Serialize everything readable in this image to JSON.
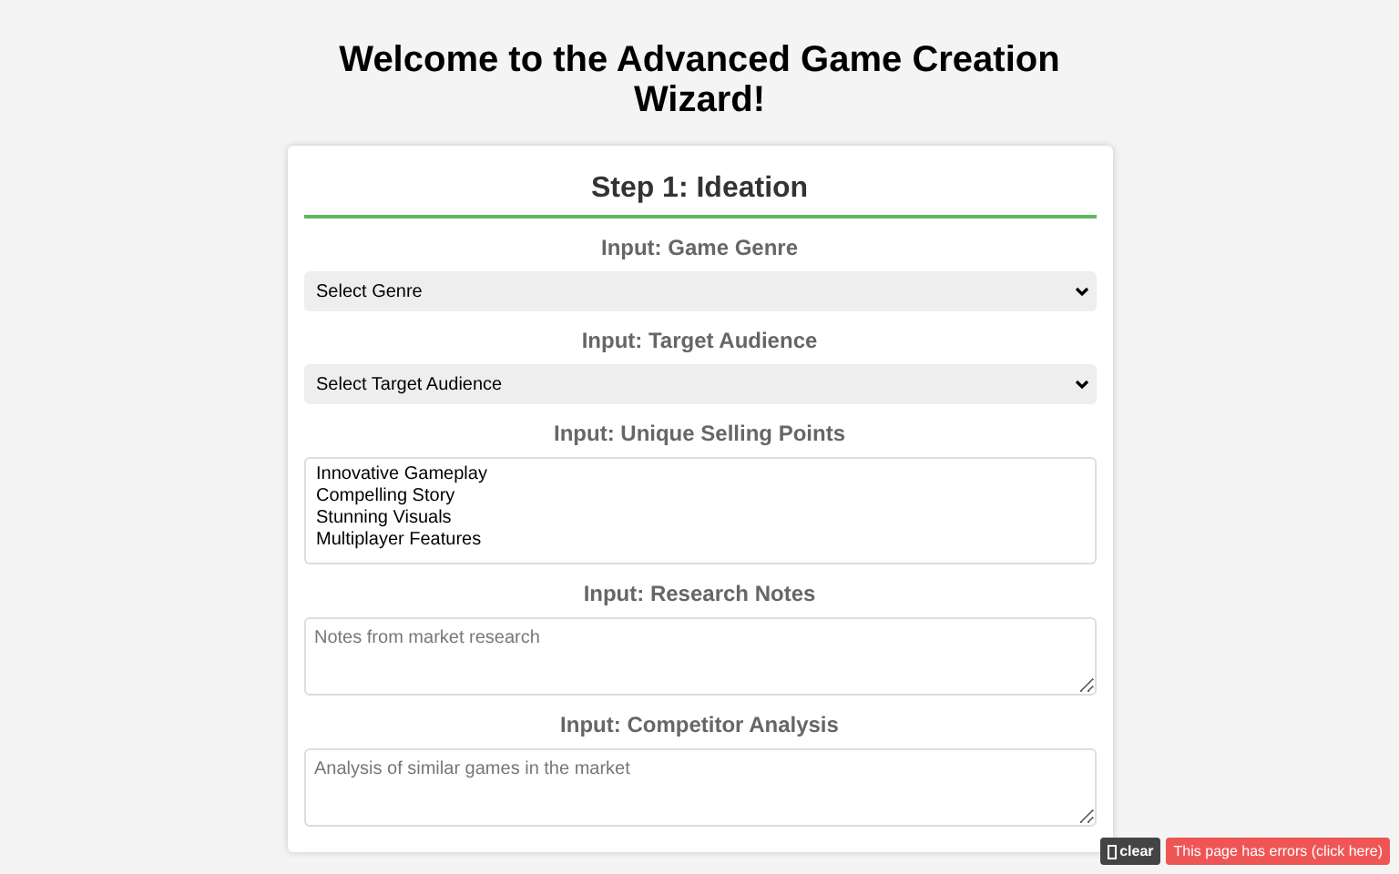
{
  "title": "Welcome to the Advanced Game Creation Wizard!",
  "step": {
    "heading": "Step 1: Ideation",
    "fields": [
      {
        "kind": "select",
        "label": "Input: Game Genre",
        "value": "Select Genre"
      },
      {
        "kind": "select",
        "label": "Input: Target Audience",
        "value": "Select Target Audience"
      },
      {
        "kind": "listbox",
        "label": "Input: Unique Selling Points",
        "options": [
          "Innovative Gameplay",
          "Compelling Story",
          "Stunning Visuals",
          "Multiplayer Features"
        ]
      },
      {
        "kind": "textarea",
        "label": "Input: Research Notes",
        "placeholder": "Notes from market research"
      },
      {
        "kind": "textarea",
        "label": "Input: Competitor Analysis",
        "placeholder": "Analysis of similar games in the market"
      }
    ]
  },
  "overlay": {
    "clear_label": "clear",
    "error_label": "This page has errors (click here)"
  }
}
